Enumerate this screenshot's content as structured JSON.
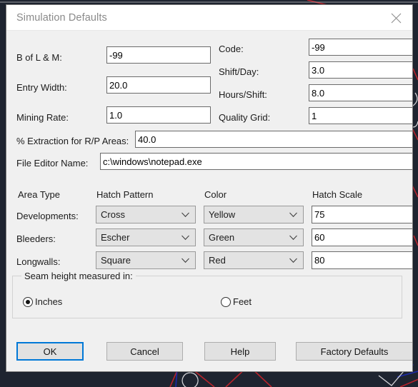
{
  "window": {
    "title": "Simulation Defaults",
    "close_icon": "close-icon",
    "accent_focus_color": "#0078d7",
    "dialog_bg": "#f0f0f0",
    "titlebar_bg": "#ffffff",
    "desktop_bg": "#1e2430"
  },
  "fields": {
    "left": [
      {
        "label": "B of L & M:",
        "value": "-99"
      },
      {
        "label": "Entry Width:",
        "value": "20.0"
      },
      {
        "label": "Mining Rate:",
        "value": "1.0"
      }
    ],
    "right": [
      {
        "label": "Code:",
        "value": "-99"
      },
      {
        "label": "Shift/Day:",
        "value": "3.0"
      },
      {
        "label": "Hours/Shift:",
        "value": "8.0"
      },
      {
        "label": "Quality Grid:",
        "value": "1"
      }
    ],
    "wide": [
      {
        "label": "% Extraction for R/P Areas:",
        "value": "40.0"
      },
      {
        "label": "File Editor Name:",
        "value": "c:\\windows\\notepad.exe"
      }
    ]
  },
  "area_table": {
    "headers": [
      "Area Type",
      "Hatch Pattern",
      "Color",
      "Hatch Scale"
    ],
    "rows": [
      {
        "area": "Developments:",
        "hatch": "Cross",
        "color": "Yellow",
        "scale": "75"
      },
      {
        "area": "Bleeders:",
        "hatch": "Escher",
        "color": "Green",
        "scale": "60"
      },
      {
        "area": "Longwalls:",
        "hatch": "Square",
        "color": "Red",
        "scale": "80"
      }
    ]
  },
  "seam_group": {
    "legend": "Seam height measured in:",
    "options": [
      {
        "label": "Inches",
        "selected": true
      },
      {
        "label": "Feet",
        "selected": false
      }
    ]
  },
  "buttons": [
    {
      "label": "OK",
      "focused": true
    },
    {
      "label": "Cancel",
      "focused": false
    },
    {
      "label": "Help",
      "focused": false
    },
    {
      "label": "Factory Defaults",
      "focused": false
    }
  ]
}
